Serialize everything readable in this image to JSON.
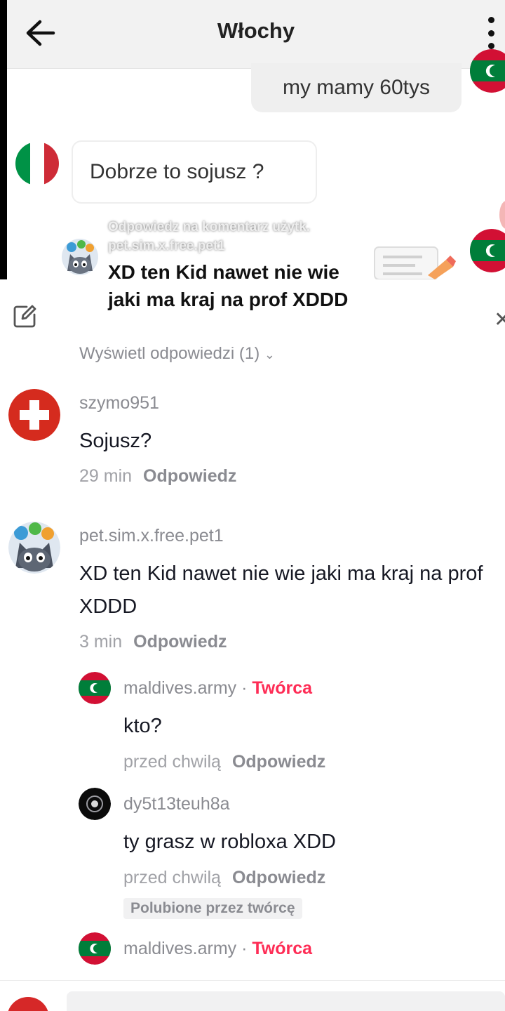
{
  "chat": {
    "title": "Włochy",
    "messages": [
      {
        "from": "me",
        "text": "my mamy 60tys"
      },
      {
        "from": "other",
        "text": "Dobrze  to sojusz ?"
      }
    ]
  },
  "reply_overlay": {
    "reference_line1": "Odpowiedz na komentarz użytk.",
    "reference_line2": "pet.sim.x.free.pet1",
    "text": "XD ten Kid nawet nie wie jaki ma kraj na prof XDDD"
  },
  "comments_panel": {
    "view_replies": "Wyświetl odpowiedzi (1)",
    "comments": [
      {
        "username": "szymo951",
        "text": "Sojusz?",
        "time": "29 min",
        "reply_label": "Odpowiedz",
        "avatar_icon": "swiss-flag-icon"
      },
      {
        "username": "pet.sim.x.free.pet1",
        "text": "XD ten Kid nawet nie wie jaki ma kraj na prof XDDD",
        "time": "3 min",
        "reply_label": "Odpowiedz",
        "avatar_icon": "cat-avatar-icon",
        "replies": [
          {
            "username": "maldives.army",
            "creator_label": "Twórca",
            "separator": "·",
            "text": "kto?",
            "time": "przed chwilą",
            "reply_label": "Odpowiedz",
            "avatar_icon": "maldives-flag-icon"
          },
          {
            "username": "dy5t13teuh8a",
            "text": "ty grasz w robloxa XDD",
            "time": "przed chwilą",
            "reply_label": "Odpowiedz",
            "badge": "Polubione przez twórcę",
            "avatar_icon": "dark-avatar-icon"
          },
          {
            "username": "maldives.army",
            "creator_label": "Twórca",
            "separator": "·",
            "avatar_icon": "maldives-flag-icon"
          }
        ]
      }
    ]
  },
  "colors": {
    "creator_accent": "#fe2c55",
    "muted_text": "#8a8b91",
    "maldives_red": "#d21034",
    "maldives_green": "#007e3a"
  }
}
